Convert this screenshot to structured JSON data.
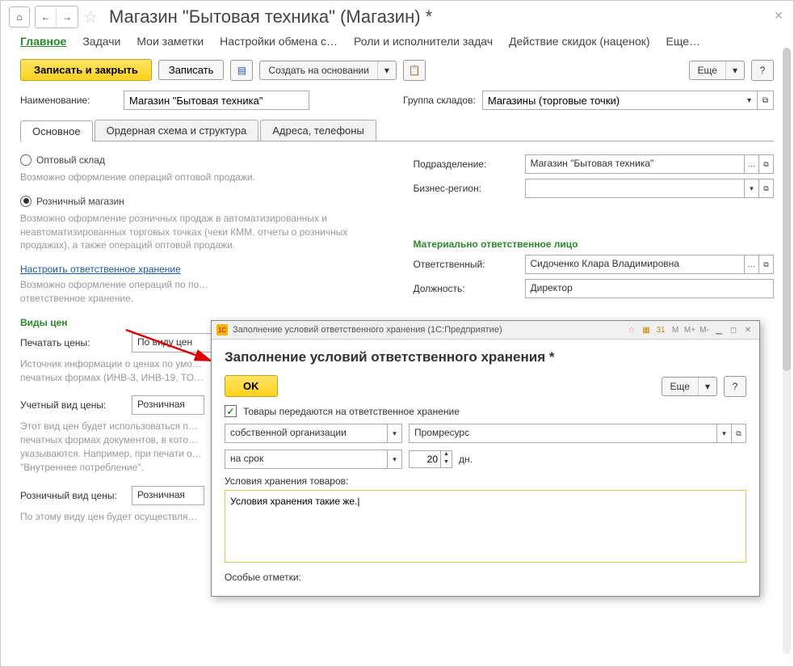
{
  "header": {
    "title": "Магазин \"Бытовая техника\"  (Магазин) *"
  },
  "nav": {
    "items": [
      "Главное",
      "Задачи",
      "Мои заметки",
      "Настройки обмена с…",
      "Роли и исполнители задач",
      "Действие скидок (наценок)",
      "Еще…"
    ]
  },
  "toolbar": {
    "save_close": "Записать и закрыть",
    "save": "Записать",
    "create_from": "Создать на основании",
    "more": "Еще",
    "help": "?"
  },
  "form": {
    "name_label": "Наименование:",
    "name_value": "Магазин \"Бытовая техника\"",
    "group_label": "Группа складов:",
    "group_value": "Магазины (торговые точки)"
  },
  "tabs": {
    "items": [
      "Основное",
      "Ордерная схема и структура",
      "Адреса, телефоны"
    ]
  },
  "main": {
    "radio_wholesale": "Оптовый склад",
    "desc_wholesale": "Возможно оформление операций оптовой продажи.",
    "radio_retail": "Розничный магазин",
    "desc_retail": "Возможно оформление розничных продаж в автоматизированных и неавтоматизированных торговых точках (чеки КММ, отчеты о розничных продажах), а также операций оптовой продажи.",
    "link_storage": "Настроить ответственное хранение",
    "desc_link": "Возможно оформление операций по по…\nответственное хранение.",
    "prices_header": "Виды цен",
    "print_label": "Печатать цены:",
    "print_value": "По виду цен",
    "desc_print": "Источник информации о ценах по умо…\nпечатных формах (ИНВ-3, ИНВ-19, ТО…",
    "acc_label": "Учетный вид цены:",
    "acc_value": "Розничная",
    "desc_acc": "Этот вид цен будет использоваться п…\nпечатных формах документов, в кото…\nуказываются. Например, при печати о…\n\"Внутреннее потребление\".",
    "ret_label": "Розничный вид цены:",
    "ret_value": "Розничная",
    "desc_ret": "По этому виду цен будет осуществля…"
  },
  "right": {
    "dept_label": "Подразделение:",
    "dept_value": "Магазин \"Бытовая техника\"",
    "region_label": "Бизнес-регион:",
    "region_value": "",
    "resp_header": "Материально ответственное лицо",
    "resp_label": "Ответственный:",
    "resp_value": "Сидоченко Клара Владимировна",
    "pos_label": "Должность:",
    "pos_value": "Директор"
  },
  "modal": {
    "titlebar": "Заполнение условий ответственного хранения  (1С:Предприятие)",
    "heading": "Заполнение условий ответственного хранения *",
    "ok": "OK",
    "more": "Еще",
    "help": "?",
    "checkbox_label": "Товары передаются на ответственное хранение",
    "org_type": "собственной организации",
    "org_value": "Промресурс",
    "term_type": "на срок",
    "days": "20",
    "days_unit": "дн.",
    "cond_label": "Условия хранения товаров:",
    "cond_text": "Условия хранения такие же.",
    "notes_label": "Особые отметки:",
    "mbuttons": [
      "M",
      "M+",
      "M-"
    ]
  }
}
